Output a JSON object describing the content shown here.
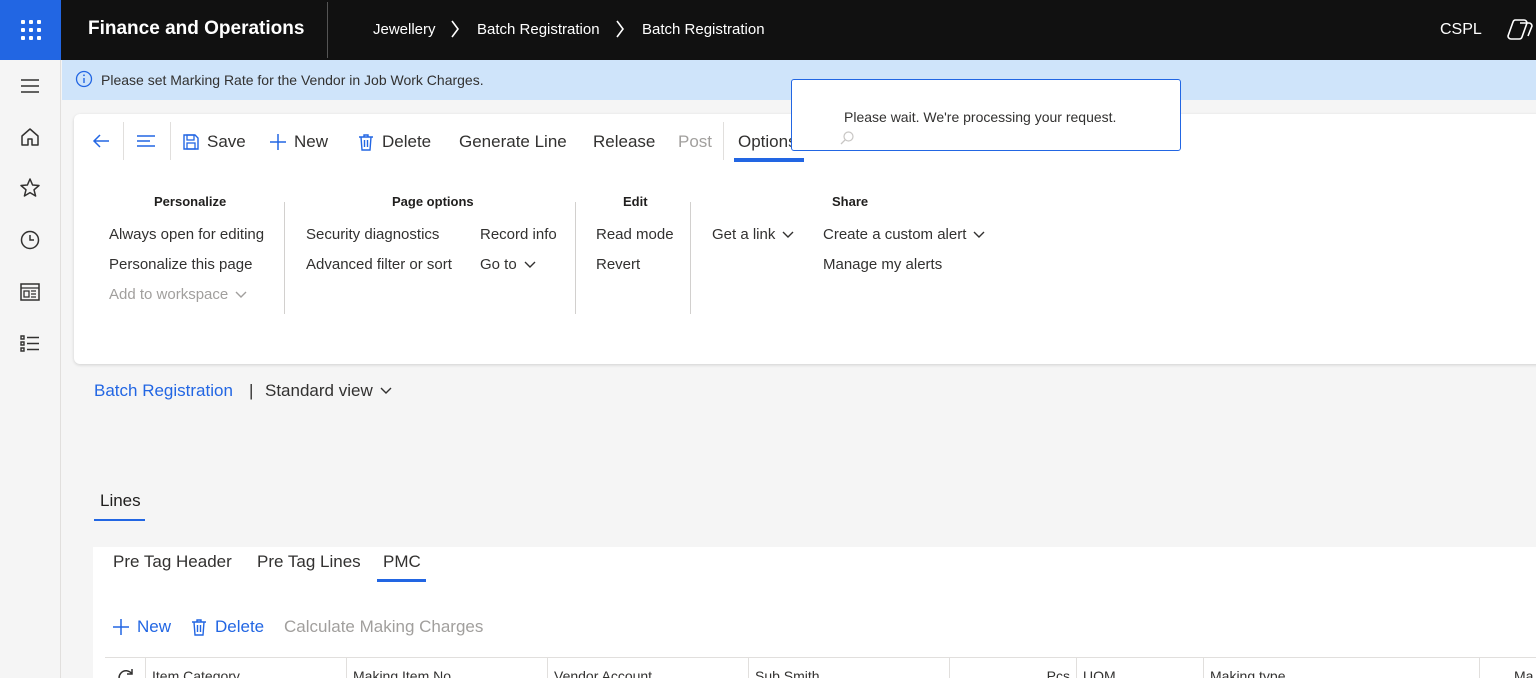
{
  "topbar": {
    "app_title": "Finance and Operations",
    "breadcrumbs": [
      "Jewellery",
      "Batch Registration",
      "Batch Registration"
    ],
    "company": "CSPL"
  },
  "message": {
    "text": "Please set Marking Rate for the Vendor in Job Work Charges."
  },
  "popup": {
    "text": "Please wait. We're processing your request."
  },
  "action_pane": {
    "save": "Save",
    "new": "New",
    "delete": "Delete",
    "generate_line": "Generate Line",
    "release": "Release",
    "post": "Post",
    "options": "Options"
  },
  "groups": {
    "personalize": {
      "title": "Personalize",
      "always_open": "Always open for editing",
      "personalize_page": "Personalize this page",
      "add_workspace": "Add to workspace"
    },
    "page_options": {
      "title": "Page options",
      "security": "Security diagnostics",
      "advanced_filter": "Advanced filter or sort",
      "record_info": "Record info",
      "go_to": "Go to"
    },
    "edit": {
      "title": "Edit",
      "read_mode": "Read mode",
      "revert": "Revert"
    },
    "share": {
      "title": "Share",
      "get_link": "Get a link",
      "custom_alert": "Create a custom alert",
      "manage_alerts": "Manage my alerts"
    }
  },
  "page": {
    "title_link": "Batch Registration",
    "separator": "|",
    "view": "Standard view"
  },
  "lines_tab": "Lines",
  "subtabs": [
    "Pre Tag Header",
    "Pre Tag Lines",
    "PMC"
  ],
  "sub_actions": {
    "new": "New",
    "delete": "Delete",
    "calculate": "Calculate Making Charges"
  },
  "grid": {
    "columns": [
      "Item Category",
      "Making Item No.",
      "Vendor Account",
      "Sub Smith",
      "Pcs",
      "UOM",
      "Making type",
      "Ma"
    ]
  },
  "colors": {
    "accent": "#2266e3",
    "topbar": "#111111",
    "message_bg": "#cfe4fa"
  }
}
